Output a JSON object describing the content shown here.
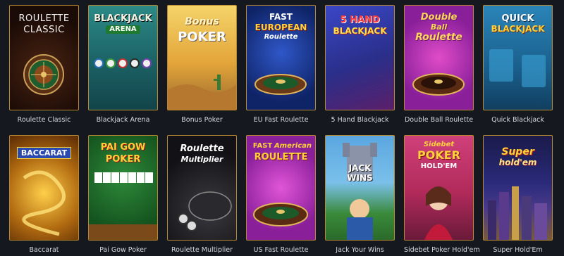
{
  "games": [
    {
      "label": "Roulette Classic",
      "logo": [
        "ROULETTE",
        "CLASSIC"
      ]
    },
    {
      "label": "Blackjack Arena",
      "logo": [
        "BLACKJACK",
        "ARENA"
      ]
    },
    {
      "label": "Bonus Poker",
      "logo": [
        "Bonus",
        "POKER"
      ]
    },
    {
      "label": "EU Fast Roulette",
      "logo": [
        "FAST",
        "EUROPEAN",
        "Roulette"
      ]
    },
    {
      "label": "5 Hand Blackjack",
      "logo": [
        "5 HAND",
        "BLACKJACK"
      ]
    },
    {
      "label": "Double Ball Roulette",
      "logo": [
        "Double",
        "Ball",
        "Roulette"
      ]
    },
    {
      "label": "Quick Blackjack",
      "logo": [
        "QUICK",
        "BLACKJACK"
      ]
    },
    {
      "label": "Baccarat",
      "logo": [
        "BACCARAT"
      ]
    },
    {
      "label": "Pai Gow Poker",
      "logo": [
        "PAI GOW",
        "POKER"
      ]
    },
    {
      "label": "Roulette Multiplier",
      "logo": [
        "Roulette",
        "Multiplier"
      ]
    },
    {
      "label": "US Fast Roulette",
      "logo": [
        "FAST",
        "American",
        "ROULETTE"
      ]
    },
    {
      "label": "Jack Your Wins",
      "logo": [
        "JACK",
        "WINS"
      ]
    },
    {
      "label": "Sidebet Poker Hold'em",
      "logo": [
        "Sidebet",
        "POKER",
        "HOLD'EM"
      ]
    },
    {
      "label": "Super Hold'Em",
      "logo": [
        "Super",
        "hold'em"
      ]
    }
  ],
  "colors": {
    "page_bg": "#15181f",
    "tile_border": "#b8892e",
    "label_text": "#d6d8de"
  }
}
